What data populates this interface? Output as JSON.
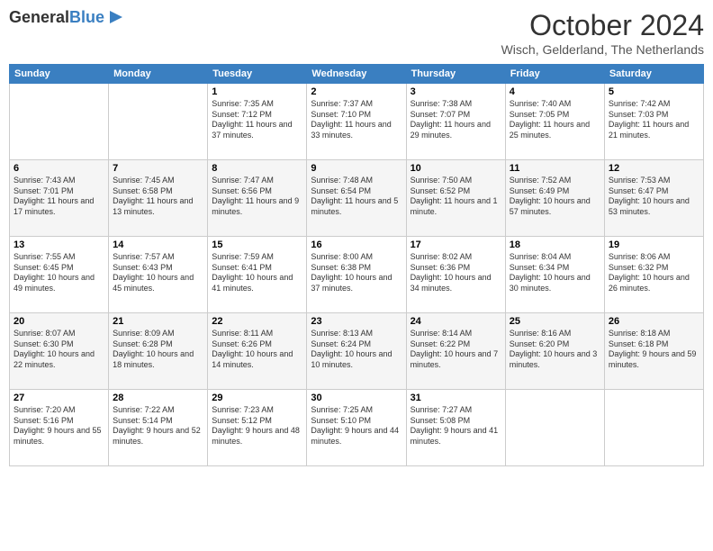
{
  "header": {
    "logo_general": "General",
    "logo_blue": "Blue",
    "month_title": "October 2024",
    "location": "Wisch, Gelderland, The Netherlands"
  },
  "days_of_week": [
    "Sunday",
    "Monday",
    "Tuesday",
    "Wednesday",
    "Thursday",
    "Friday",
    "Saturday"
  ],
  "weeks": [
    [
      {
        "day": "",
        "info": ""
      },
      {
        "day": "",
        "info": ""
      },
      {
        "day": "1",
        "info": "Sunrise: 7:35 AM\nSunset: 7:12 PM\nDaylight: 11 hours and 37 minutes."
      },
      {
        "day": "2",
        "info": "Sunrise: 7:37 AM\nSunset: 7:10 PM\nDaylight: 11 hours and 33 minutes."
      },
      {
        "day": "3",
        "info": "Sunrise: 7:38 AM\nSunset: 7:07 PM\nDaylight: 11 hours and 29 minutes."
      },
      {
        "day": "4",
        "info": "Sunrise: 7:40 AM\nSunset: 7:05 PM\nDaylight: 11 hours and 25 minutes."
      },
      {
        "day": "5",
        "info": "Sunrise: 7:42 AM\nSunset: 7:03 PM\nDaylight: 11 hours and 21 minutes."
      }
    ],
    [
      {
        "day": "6",
        "info": "Sunrise: 7:43 AM\nSunset: 7:01 PM\nDaylight: 11 hours and 17 minutes."
      },
      {
        "day": "7",
        "info": "Sunrise: 7:45 AM\nSunset: 6:58 PM\nDaylight: 11 hours and 13 minutes."
      },
      {
        "day": "8",
        "info": "Sunrise: 7:47 AM\nSunset: 6:56 PM\nDaylight: 11 hours and 9 minutes."
      },
      {
        "day": "9",
        "info": "Sunrise: 7:48 AM\nSunset: 6:54 PM\nDaylight: 11 hours and 5 minutes."
      },
      {
        "day": "10",
        "info": "Sunrise: 7:50 AM\nSunset: 6:52 PM\nDaylight: 11 hours and 1 minute."
      },
      {
        "day": "11",
        "info": "Sunrise: 7:52 AM\nSunset: 6:49 PM\nDaylight: 10 hours and 57 minutes."
      },
      {
        "day": "12",
        "info": "Sunrise: 7:53 AM\nSunset: 6:47 PM\nDaylight: 10 hours and 53 minutes."
      }
    ],
    [
      {
        "day": "13",
        "info": "Sunrise: 7:55 AM\nSunset: 6:45 PM\nDaylight: 10 hours and 49 minutes."
      },
      {
        "day": "14",
        "info": "Sunrise: 7:57 AM\nSunset: 6:43 PM\nDaylight: 10 hours and 45 minutes."
      },
      {
        "day": "15",
        "info": "Sunrise: 7:59 AM\nSunset: 6:41 PM\nDaylight: 10 hours and 41 minutes."
      },
      {
        "day": "16",
        "info": "Sunrise: 8:00 AM\nSunset: 6:38 PM\nDaylight: 10 hours and 37 minutes."
      },
      {
        "day": "17",
        "info": "Sunrise: 8:02 AM\nSunset: 6:36 PM\nDaylight: 10 hours and 34 minutes."
      },
      {
        "day": "18",
        "info": "Sunrise: 8:04 AM\nSunset: 6:34 PM\nDaylight: 10 hours and 30 minutes."
      },
      {
        "day": "19",
        "info": "Sunrise: 8:06 AM\nSunset: 6:32 PM\nDaylight: 10 hours and 26 minutes."
      }
    ],
    [
      {
        "day": "20",
        "info": "Sunrise: 8:07 AM\nSunset: 6:30 PM\nDaylight: 10 hours and 22 minutes."
      },
      {
        "day": "21",
        "info": "Sunrise: 8:09 AM\nSunset: 6:28 PM\nDaylight: 10 hours and 18 minutes."
      },
      {
        "day": "22",
        "info": "Sunrise: 8:11 AM\nSunset: 6:26 PM\nDaylight: 10 hours and 14 minutes."
      },
      {
        "day": "23",
        "info": "Sunrise: 8:13 AM\nSunset: 6:24 PM\nDaylight: 10 hours and 10 minutes."
      },
      {
        "day": "24",
        "info": "Sunrise: 8:14 AM\nSunset: 6:22 PM\nDaylight: 10 hours and 7 minutes."
      },
      {
        "day": "25",
        "info": "Sunrise: 8:16 AM\nSunset: 6:20 PM\nDaylight: 10 hours and 3 minutes."
      },
      {
        "day": "26",
        "info": "Sunrise: 8:18 AM\nSunset: 6:18 PM\nDaylight: 9 hours and 59 minutes."
      }
    ],
    [
      {
        "day": "27",
        "info": "Sunrise: 7:20 AM\nSunset: 5:16 PM\nDaylight: 9 hours and 55 minutes."
      },
      {
        "day": "28",
        "info": "Sunrise: 7:22 AM\nSunset: 5:14 PM\nDaylight: 9 hours and 52 minutes."
      },
      {
        "day": "29",
        "info": "Sunrise: 7:23 AM\nSunset: 5:12 PM\nDaylight: 9 hours and 48 minutes."
      },
      {
        "day": "30",
        "info": "Sunrise: 7:25 AM\nSunset: 5:10 PM\nDaylight: 9 hours and 44 minutes."
      },
      {
        "day": "31",
        "info": "Sunrise: 7:27 AM\nSunset: 5:08 PM\nDaylight: 9 hours and 41 minutes."
      },
      {
        "day": "",
        "info": ""
      },
      {
        "day": "",
        "info": ""
      }
    ]
  ]
}
